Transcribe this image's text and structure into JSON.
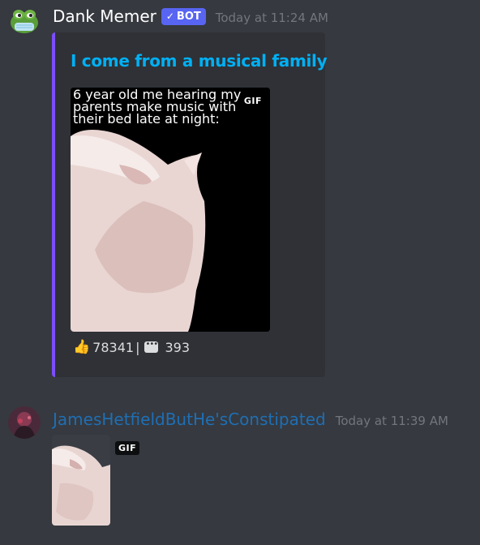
{
  "messages": [
    {
      "username": "Dank Memer",
      "bot_tag": "BOT",
      "timestamp": "Today at 11:24 AM",
      "avatar_icon": "pepe-frog-avatar",
      "embed": {
        "accent_color": "#7c4dff",
        "title": "I come from a musical family",
        "image_caption": "6 year old me hearing my parents make music with their bed late at night:",
        "image_badge": "GIF",
        "footer": {
          "likes": "78341",
          "separator": "|",
          "comments": "393"
        }
      }
    },
    {
      "username": "JamesHetfieldButHe'sConstipated",
      "timestamp": "Today at 11:39 AM",
      "avatar_icon": "user-avatar",
      "attachment_badge": "GIF"
    }
  ],
  "colors": {
    "background": "#36393f",
    "embed_background": "#2f3136",
    "embed_title": "#00b0f4",
    "bot_tag": "#5865f2",
    "username_2": "#1e6fb5",
    "timestamp": "#72767d"
  }
}
